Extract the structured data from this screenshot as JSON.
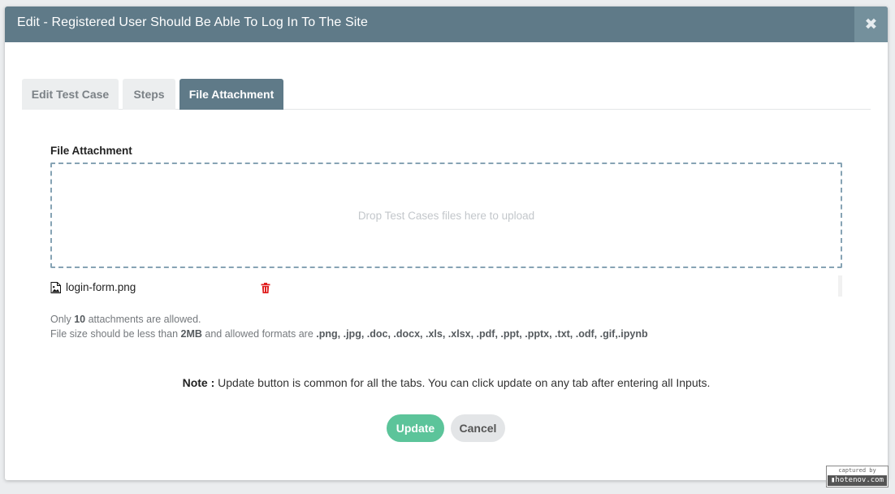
{
  "modal": {
    "title": "Edit - Registered User Should Be Able To Log In To The Site",
    "close_glyph": "✖"
  },
  "tabs": [
    {
      "label": "Edit Test Case",
      "active": false
    },
    {
      "label": "Steps",
      "active": false
    },
    {
      "label": "File Attachment",
      "active": true
    }
  ],
  "attachment": {
    "section_label": "File Attachment",
    "dropzone_text": "Drop Test Cases files here to upload",
    "files": [
      {
        "name": "login-form.png",
        "icon": "image-file-icon",
        "delete_icon": "trash-icon"
      }
    ],
    "limit_prefix": "Only ",
    "limit_count": "10",
    "limit_suffix": " attachments are allowed.",
    "size_prefix": "File size should be less than ",
    "size_value": "2MB",
    "size_middle": " and allowed formats are ",
    "formats": ".png, .jpg, .doc, .docx, .xls, .xlsx, .pdf, .ppt, .pptx, .txt, .odf, .gif,.ipynb"
  },
  "note": {
    "label": "Note :",
    "text": " Update button is common for all the tabs. You can click update on any tab after entering all Inputs."
  },
  "buttons": {
    "update": "Update",
    "cancel": "Cancel"
  },
  "watermark": {
    "top": "captured by",
    "bottom": "▮hotenov.com"
  },
  "colors": {
    "header": "#5f7a88",
    "close_bg": "#74909c",
    "update": "#5cc49a",
    "delete": "#e02020",
    "dropzone_border": "#86a3b4"
  }
}
